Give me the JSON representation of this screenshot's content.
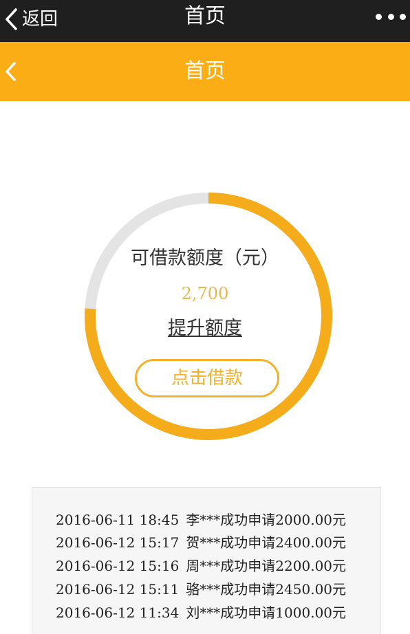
{
  "status_bar": {
    "back_label": "返回",
    "title": "首页",
    "icons": {
      "back": "chevron-left-icon",
      "more": "more-dots-icon"
    }
  },
  "nav_bar": {
    "title": "首页",
    "background": "#fbad16",
    "icons": {
      "back": "chevron-left-icon"
    }
  },
  "credit": {
    "label": "可借款额度（元）",
    "amount": "2,700",
    "used_fraction": 0.24,
    "raise_label": "提升额度",
    "borrow_label": "点击借款",
    "accent": "#f5ac1a",
    "track": "#e4e4e4"
  },
  "records": [
    {
      "time": "2016-06-11 18:45",
      "message": "李***成功申请2000.00元"
    },
    {
      "time": "2016-06-12 15:17",
      "message": "贺***成功申请2400.00元"
    },
    {
      "time": "2016-06-12 15:16",
      "message": "周***成功申请2200.00元"
    },
    {
      "time": "2016-06-12 15:11",
      "message": "骆***成功申请2450.00元"
    },
    {
      "time": "2016-06-12 11:34",
      "message": "刘***成功申请1000.00元"
    }
  ]
}
